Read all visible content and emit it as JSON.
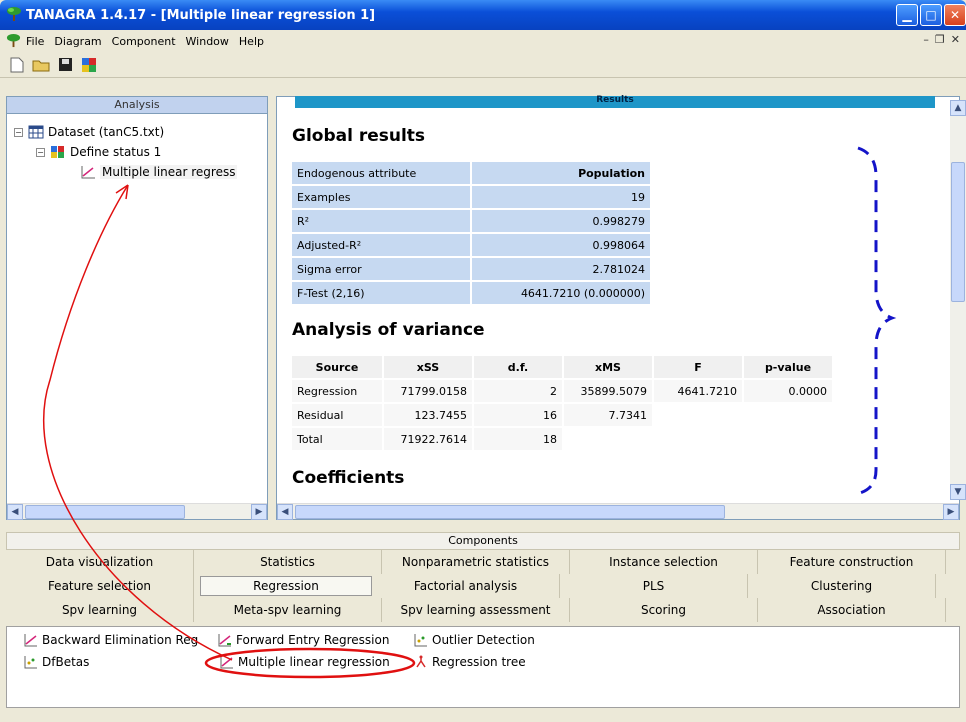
{
  "window": {
    "title": "TANAGRA 1.4.17 - [Multiple linear regression 1]"
  },
  "menu": [
    "File",
    "Diagram",
    "Component",
    "Window",
    "Help"
  ],
  "analysis": {
    "header": "Analysis",
    "tree": [
      {
        "label": "Dataset (tanC5.txt)"
      },
      {
        "label": "Define status 1"
      },
      {
        "label": "Multiple linear regress"
      }
    ]
  },
  "results": {
    "bar_label": "Results",
    "global_title": "Global results",
    "global_table": {
      "header": [
        "Endogenous attribute",
        "Population"
      ],
      "rows": [
        [
          "Examples",
          "19"
        ],
        [
          "R²",
          "0.998279"
        ],
        [
          "Adjusted-R²",
          "0.998064"
        ],
        [
          "Sigma error",
          "2.781024"
        ],
        [
          "F-Test (2,16)",
          "4641.7210 (0.000000)"
        ]
      ]
    },
    "anova_title": "Analysis of variance",
    "anova_table": {
      "header": [
        "Source",
        "xSS",
        "d.f.",
        "xMS",
        "F",
        "p-value"
      ],
      "rows": [
        [
          "Regression",
          "71799.0158",
          "2",
          "35899.5079",
          "4641.7210",
          "0.0000"
        ],
        [
          "Residual",
          "123.7455",
          "16",
          "7.7341",
          "",
          ""
        ],
        [
          "Total",
          "71922.7614",
          "18",
          "",
          "",
          ""
        ]
      ]
    },
    "coef_title": "Coefficients"
  },
  "components": {
    "header": "Components",
    "tabs": [
      [
        "Data visualization",
        "Statistics",
        "Nonparametric statistics",
        "Instance selection",
        "Feature construction"
      ],
      [
        "Feature selection",
        "Regression",
        "Factorial analysis",
        "PLS",
        "Clustering"
      ],
      [
        "Spv learning",
        "Meta-spv learning",
        "Spv learning assessment",
        "Scoring",
        "Association"
      ]
    ],
    "active_tab": "Regression",
    "items": [
      "Backward Elimination Reg",
      "Forward Entry Regression",
      "Outlier Detection",
      "DfBetas",
      "Multiple linear regression",
      "Regression tree"
    ]
  }
}
